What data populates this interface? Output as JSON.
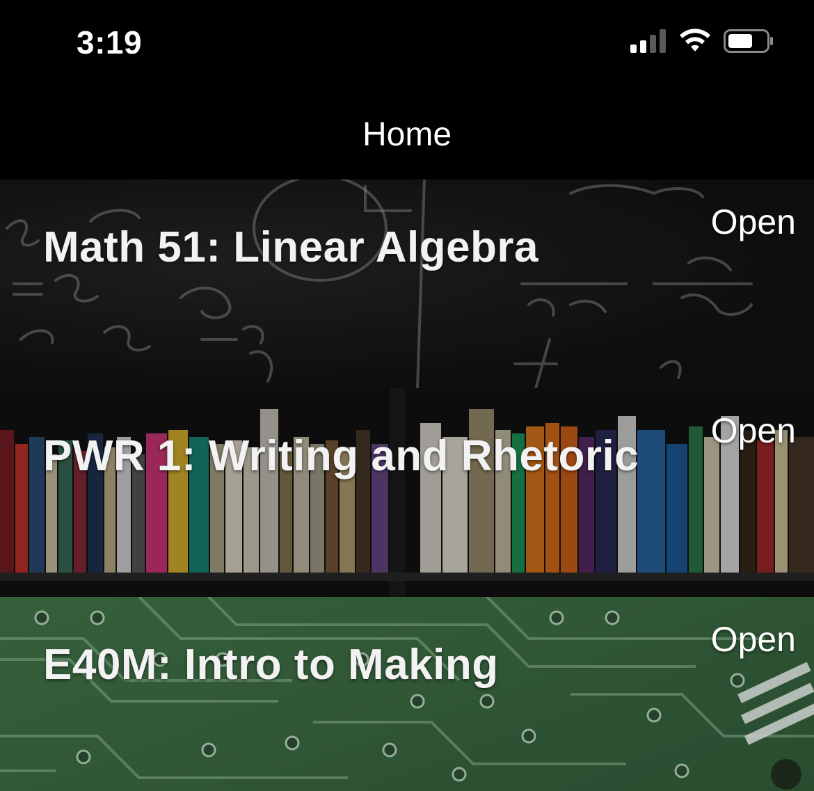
{
  "status_bar": {
    "time": "3:19",
    "icons": [
      "cellular-signal-icon",
      "wifi-icon",
      "battery-icon"
    ]
  },
  "nav": {
    "title": "Home"
  },
  "courses": [
    {
      "title": "Math 51: Linear Algebra",
      "action": "Open",
      "background": "chalkboard-image"
    },
    {
      "title": "PWR 1: Writing and Rhetoric",
      "action": "Open",
      "background": "bookshelf-image"
    },
    {
      "title": "E40M: Intro to Making",
      "action": "Open",
      "background": "circuit-board-image"
    }
  ],
  "colors": {
    "background": "#000000",
    "text": "#ffffff",
    "circuit_green": "#3e6e45"
  }
}
